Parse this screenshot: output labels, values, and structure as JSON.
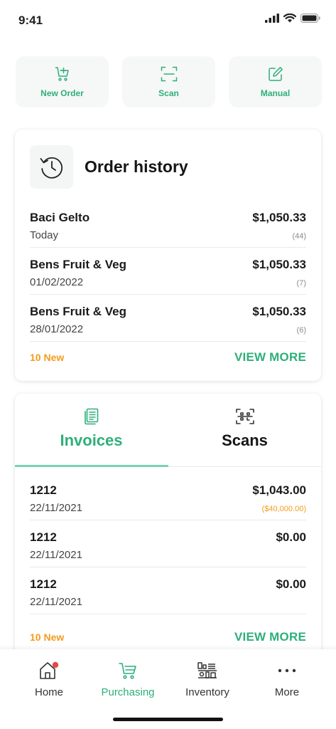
{
  "status_bar": {
    "time": "9:41"
  },
  "quick_actions": [
    {
      "label": "New Order",
      "icon": "cart-plus-icon"
    },
    {
      "label": "Scan",
      "icon": "scan-frame-icon"
    },
    {
      "label": "Manual",
      "icon": "edit-square-icon"
    }
  ],
  "order_history": {
    "title": "Order history",
    "icon": "history-icon",
    "rows": [
      {
        "name": "Baci Gelto",
        "date": "Today",
        "amount": "$1,050.33",
        "count": "(44)"
      },
      {
        "name": "Bens Fruit & Veg",
        "date": "01/02/2022",
        "amount": "$1,050.33",
        "count": "(7)"
      },
      {
        "name": "Bens Fruit & Veg",
        "date": "28/01/2022",
        "amount": "$1,050.33",
        "count": "(6)"
      }
    ],
    "new_badge": "10 New",
    "view_more": "VIEW MORE"
  },
  "invoices_card": {
    "tabs": [
      {
        "label": "Invoices",
        "icon": "invoice-icon",
        "active": true
      },
      {
        "label": "Scans",
        "icon": "scan-icon",
        "active": false
      }
    ],
    "rows": [
      {
        "number": "1212",
        "date": "22/11/2021",
        "amount": "$1,043.00",
        "note": "($40,000.00)"
      },
      {
        "number": "1212",
        "date": "22/11/2021",
        "amount": "$0.00",
        "note": ""
      },
      {
        "number": "1212",
        "date": "22/11/2021",
        "amount": "$0.00",
        "note": ""
      }
    ],
    "new_badge": "10 New",
    "view_more": "VIEW MORE"
  },
  "bottom_nav": [
    {
      "label": "Home",
      "icon": "home-icon",
      "active": false
    },
    {
      "label": "Purchasing",
      "icon": "cart-icon",
      "active": true
    },
    {
      "label": "Inventory",
      "icon": "inventory-icon",
      "active": false
    },
    {
      "label": "More",
      "icon": "more-dots-icon",
      "active": false
    }
  ],
  "colors": {
    "accent": "#2eaf7a",
    "orange": "#f39c1e",
    "notification_dot": "#e5484d"
  }
}
